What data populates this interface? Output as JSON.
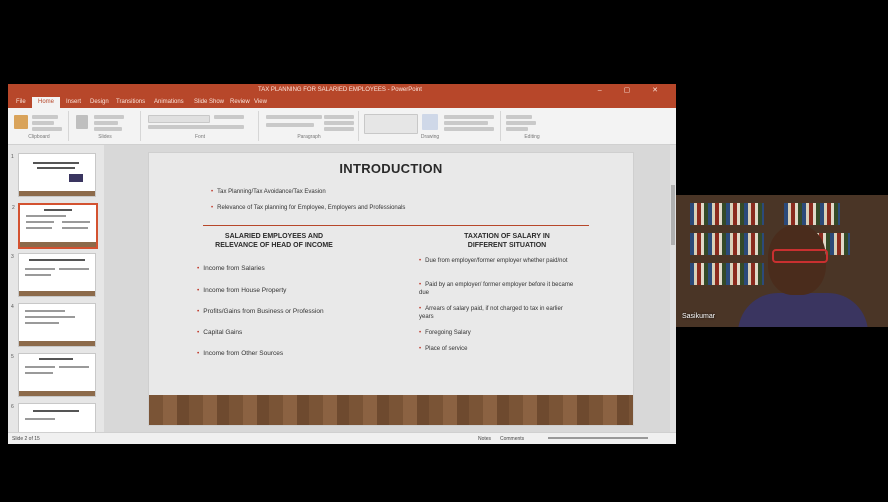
{
  "window": {
    "title": "TAX PLANNING FOR SALARIED EMPLOYEES - PowerPoint"
  },
  "ribbon": {
    "tabs": [
      "File",
      "Home",
      "Insert",
      "Design",
      "Transitions",
      "Animations",
      "Slide Show",
      "Review",
      "View"
    ],
    "groups": [
      "Clipboard",
      "Slides",
      "Font",
      "Paragraph",
      "Drawing",
      "Editing"
    ]
  },
  "slide": {
    "title": "INTRODUCTION",
    "top_bullets": [
      "Tax Planning/Tax Avoidance/Tax Evasion",
      "Relevance of Tax planning for Employee, Employers and Professionals"
    ],
    "left_heading_line1": "SALARIED EMPLOYEES AND",
    "left_heading_line2": "RELEVANCE OF HEAD OF INCOME",
    "left_bullets": [
      "Income from Salaries",
      "Income from House Property",
      "Profits/Gains from Business or Profession",
      "Capital Gains",
      "Income from Other Sources"
    ],
    "right_heading_line1": "TAXATION OF SALARY IN",
    "right_heading_line2": "DIFFERENT SITUATION",
    "right_bullets": [
      "Due from employer/former employer whether paid/not",
      "Paid by an employer/ former employer before it became due",
      "Arrears of salary paid, if not charged to tax in earlier years",
      "Foregoing Salary",
      "Place of service"
    ]
  },
  "status": {
    "slide_info": "Slide 2 of 15",
    "notes": "Notes",
    "comments": "Comments"
  },
  "video": {
    "participant": "Sasikumar"
  },
  "colors": {
    "accent": "#b7472a",
    "bullet": "#c0392b"
  }
}
